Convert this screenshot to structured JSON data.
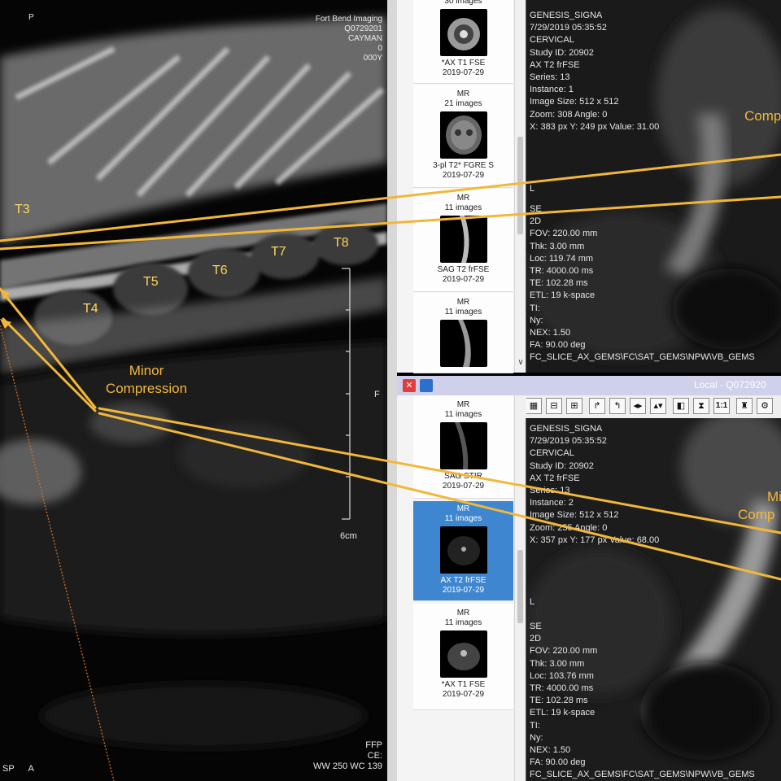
{
  "left_viewer": {
    "top_right_overlay": [
      "Fort Bend Imaging",
      "Q0729201",
      "CAYMAN",
      "0",
      "000Y"
    ],
    "vertebra_labels": [
      "T3",
      "T4",
      "T5",
      "T6",
      "T7",
      "T8"
    ],
    "annotation": {
      "line1": "Minor",
      "line2": "Compression"
    },
    "scale_label": "6cm",
    "orientation_right": "F",
    "bottom_right_overlay": [
      "FFP",
      "CE:",
      "WW 250 WC 139"
    ],
    "bottom_left_overlay": [
      "SP",
      "A"
    ],
    "top_left_mark": "P"
  },
  "series_strip_top": [
    {
      "modality": "",
      "count": "30 images",
      "label": "*AX T1 FSE",
      "date": "2019-07-29"
    },
    {
      "modality": "MR",
      "count": "21 images",
      "label": "3-pl T2* FGRE S",
      "date": "2019-07-29"
    },
    {
      "modality": "MR",
      "count": "11 images",
      "label": "SAG T2 frFSE",
      "date": "2019-07-29"
    },
    {
      "modality": "MR",
      "count": "11 images",
      "label": "",
      "date": ""
    }
  ],
  "series_strip_bottom": [
    {
      "modality": "MR",
      "count": "11 images",
      "label": "SAG STIR",
      "date": "2019-07-29"
    },
    {
      "modality": "MR",
      "count": "11 images",
      "label": "AX T2 frFSE",
      "date": "2019-07-29"
    },
    {
      "modality": "MR",
      "count": "11 images",
      "label": "*AX T1 FSE",
      "date": "2019-07-29"
    }
  ],
  "top_right_viewer": {
    "overlay": [
      "GENESIS_SIGNA",
      "7/29/2019 05:35:52",
      "CERVICAL",
      "Study ID: 20902",
      "AX T2 frFSE",
      "Series: 13",
      "Instance: 1",
      "Image Size: 512 x 512",
      "Zoom: 308 Angle: 0",
      "X: 383 px Y: 249 px Value: 31.00"
    ],
    "orient": "L",
    "params": [
      "SE",
      "2D",
      "FOV: 220.00 mm",
      "Thk: 3.00 mm",
      "Loc: 119.74 mm",
      "TR: 4000.00 ms",
      "TE: 102.28 ms",
      "ETL: 19 k-space",
      "TI:",
      "Ny:",
      "NEX: 1.50",
      "FA: 90.00 deg",
      "FC_SLICE_AX_GEMS\\FC\\SAT_GEMS\\NPW\\VB_GEMS"
    ],
    "annotation": "Comp"
  },
  "bottom_panel": {
    "title": "Local - Q072920",
    "close_label": "✕",
    "toolbar": [
      "▦",
      "⊟",
      "⊞",
      "↱",
      "↰",
      "◂▸",
      "▴▾",
      "◧",
      "⧗",
      "1:1",
      "♜",
      "⚙"
    ]
  },
  "bottom_right_viewer": {
    "overlay": [
      "GENESIS_SIGNA",
      "7/29/2019 05:35:52",
      "CERVICAL",
      "Study ID: 20902",
      "AX T2 frFSE",
      "Series: 13",
      "Instance: 2",
      "Image Size: 512 x 512",
      "Zoom: 255 Angle: 0",
      "X: 357 px Y: 177 px Value: 68.00"
    ],
    "orient": "L",
    "params": [
      "SE",
      "2D",
      "FOV: 220.00 mm",
      "Thk: 3.00 mm",
      "Loc: 103.76 mm",
      "TR: 4000.00 ms",
      "TE: 102.28 ms",
      "ETL: 19 k-space",
      "TI:",
      "Ny:",
      "NEX: 1.50",
      "FA: 90.00 deg",
      "FC_SLICE_AX_GEMS\\FC\\SAT_GEMS\\NPW\\VB_GEMS"
    ],
    "annotation": {
      "line1": "Mi",
      "line2": "Comp"
    }
  },
  "colors": {
    "annotation": "#f2b739",
    "vertebra_label": "#ffd75a",
    "selection": "#3f86d0",
    "title_bar": "#cfd0ea"
  }
}
